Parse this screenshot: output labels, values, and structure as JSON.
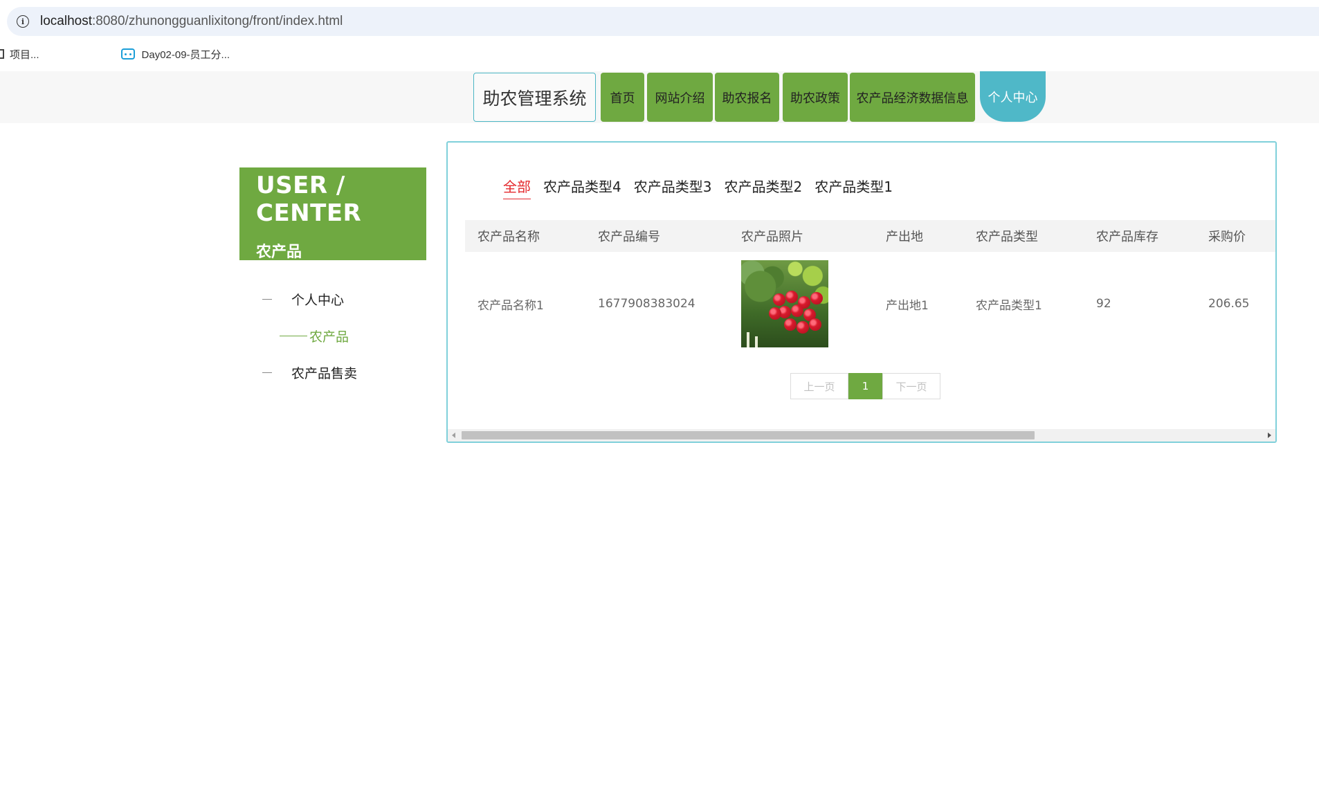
{
  "browser": {
    "url_host": "localhost",
    "url_rest": ":8080/zhunongguanlixitong/front/index.html",
    "bookmarks": [
      "项目...",
      "Day02-09-员工分..."
    ]
  },
  "header": {
    "brand": "助农管理系统",
    "nav": [
      {
        "label": "首页",
        "active": false
      },
      {
        "label": "网站介绍",
        "active": false
      },
      {
        "label": "助农报名",
        "active": false
      },
      {
        "label": "助农政策",
        "active": false
      },
      {
        "label": "农产品经济数据信息",
        "active": false
      },
      {
        "label": "个人中心",
        "active": true
      }
    ]
  },
  "sidebar": {
    "title_en": "USER / CENTER",
    "title_cn": "农产品",
    "items": [
      {
        "label": "个人中心",
        "active": false
      },
      {
        "label": "农产品",
        "active": true
      },
      {
        "label": "农产品售卖",
        "active": false
      }
    ]
  },
  "main": {
    "category_tabs": [
      {
        "label": "全部",
        "active": true
      },
      {
        "label": "农产品类型4",
        "active": false
      },
      {
        "label": "农产品类型3",
        "active": false
      },
      {
        "label": "农产品类型2",
        "active": false
      },
      {
        "label": "农产品类型1",
        "active": false
      }
    ],
    "table": {
      "columns": [
        "农产品名称",
        "农产品编号",
        "农产品照片",
        "产出地",
        "农产品类型",
        "农产品库存",
        "采购价"
      ],
      "rows": [
        {
          "name": "农产品名称1",
          "code": "1677908383024",
          "photo": "vegetables-photo",
          "origin": "产出地1",
          "type": "农产品类型1",
          "stock": "92",
          "price": "206.65"
        }
      ]
    },
    "pager": {
      "prev": "上一页",
      "current": "1",
      "next": "下一页"
    }
  },
  "colors": {
    "green": "#6fa941",
    "teal": "#4fb8c8",
    "red": "#e4282c"
  }
}
